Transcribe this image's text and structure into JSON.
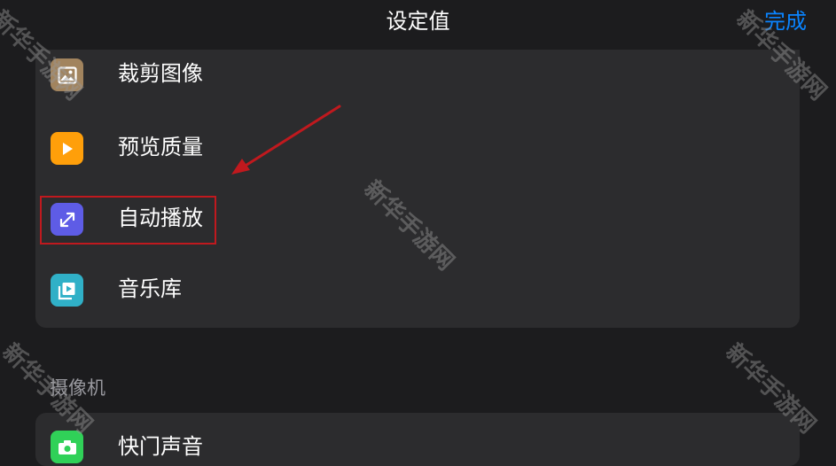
{
  "header": {
    "title": "设定值",
    "done_label": "完成"
  },
  "list": {
    "items": [
      {
        "label": "裁剪图像",
        "icon": "image-icon",
        "color": "#a2845e"
      },
      {
        "label": "预览质量",
        "icon": "play-icon",
        "color": "#ff9f0a"
      },
      {
        "label": "自动播放",
        "icon": "expand-arrows-icon",
        "color": "#5e5ce6"
      },
      {
        "label": "音乐库",
        "icon": "music-library-icon",
        "color": "#30b0c7"
      }
    ]
  },
  "camera_section": {
    "header": "摄像机",
    "first_item": {
      "label": "快门声音",
      "icon": "camera-icon",
      "color": "#30d158"
    }
  },
  "annotations": {
    "watermark": "新华手游网",
    "highlight_color": "#c0191e"
  }
}
